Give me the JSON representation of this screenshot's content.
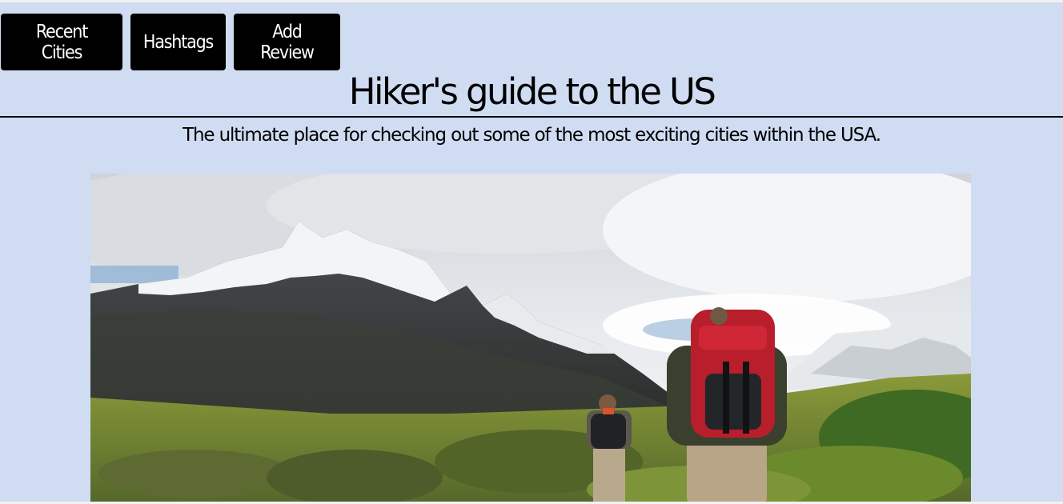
{
  "nav": {
    "recent_cities": "Recent Cities",
    "hashtags": "Hashtags",
    "add_review": "Add Review"
  },
  "header": {
    "title": "Hiker's guide to the US",
    "subtitle": "The ultimate place for checking out some of the most exciting cities within the USA."
  },
  "hero_image": {
    "subject": "two-hikers-walking-toward-snowy-mountains"
  },
  "colors": {
    "page_background": "#d0dcf2",
    "button_background": "#000000",
    "button_text": "#ffffff"
  }
}
